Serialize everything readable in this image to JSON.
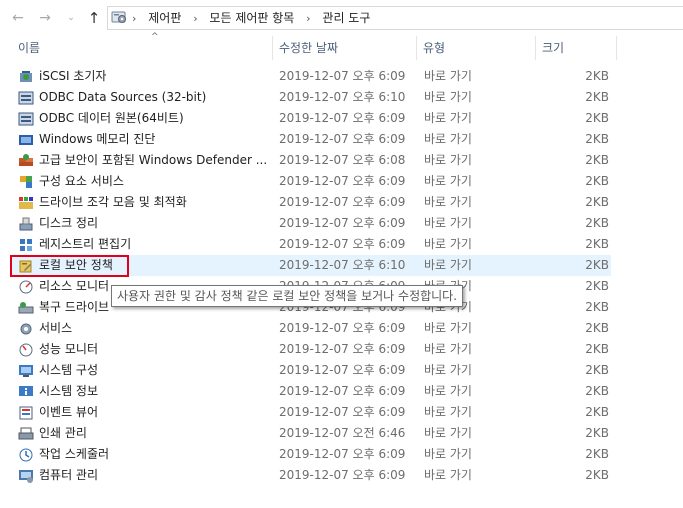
{
  "address": {
    "back_glyph": "←",
    "forward_glyph": "→",
    "dropdown_glyph": "⌄",
    "up_glyph": "↑",
    "breadcrumbs": [
      {
        "label": "제어판"
      },
      {
        "label": "모든 제어판 항목"
      },
      {
        "label": "관리 도구"
      }
    ],
    "separator": "›"
  },
  "columns": {
    "name": "이름",
    "date": "수정한 날짜",
    "type": "유형",
    "size": "크기",
    "sort_glyph": "^"
  },
  "files": [
    {
      "name": "iSCSI 초기자",
      "date": "2019-12-07 오후 6:09",
      "type": "바로 가기",
      "size": "2KB",
      "icon": "iscsi-icon"
    },
    {
      "name": "ODBC Data Sources (32-bit)",
      "date": "2019-12-07 오후 6:10",
      "type": "바로 가기",
      "size": "2KB",
      "icon": "odbc-icon"
    },
    {
      "name": "ODBC 데이터 원본(64비트)",
      "date": "2019-12-07 오후 6:09",
      "type": "바로 가기",
      "size": "2KB",
      "icon": "odbc-icon"
    },
    {
      "name": "Windows 메모리 진단",
      "date": "2019-12-07 오후 6:09",
      "type": "바로 가기",
      "size": "2KB",
      "icon": "memory-diagnostic-icon"
    },
    {
      "name": "고급 보안이 포함된 Windows Defender ...",
      "date": "2019-12-07 오후 6:08",
      "type": "바로 가기",
      "size": "2KB",
      "icon": "firewall-icon"
    },
    {
      "name": "구성 요소 서비스",
      "date": "2019-12-07 오후 6:09",
      "type": "바로 가기",
      "size": "2KB",
      "icon": "component-services-icon"
    },
    {
      "name": "드라이브 조각 모음 및 최적화",
      "date": "2019-12-07 오후 6:09",
      "type": "바로 가기",
      "size": "2KB",
      "icon": "defrag-icon"
    },
    {
      "name": "디스크 정리",
      "date": "2019-12-07 오후 6:09",
      "type": "바로 가기",
      "size": "2KB",
      "icon": "disk-cleanup-icon"
    },
    {
      "name": "레지스트리 편집기",
      "date": "2019-12-07 오후 6:09",
      "type": "바로 가기",
      "size": "2KB",
      "icon": "registry-icon"
    },
    {
      "name": "로컬 보안 정책",
      "date": "2019-12-07 오후 6:10",
      "type": "바로 가기",
      "size": "2KB",
      "icon": "security-policy-icon"
    },
    {
      "name": "리소스 모니터",
      "date": "2019-12-07 오후 6:09",
      "type": "바로 가기",
      "size": "2KB",
      "icon": "resource-monitor-icon"
    },
    {
      "name": "복구 드라이브",
      "date": "2019-12-07 오후 6:09",
      "type": "바로 가기",
      "size": "2KB",
      "icon": "recovery-drive-icon"
    },
    {
      "name": "서비스",
      "date": "2019-12-07 오후 6:09",
      "type": "바로 가기",
      "size": "2KB",
      "icon": "services-icon"
    },
    {
      "name": "성능 모니터",
      "date": "2019-12-07 오후 6:09",
      "type": "바로 가기",
      "size": "2KB",
      "icon": "performance-monitor-icon"
    },
    {
      "name": "시스템 구성",
      "date": "2019-12-07 오후 6:09",
      "type": "바로 가기",
      "size": "2KB",
      "icon": "system-config-icon"
    },
    {
      "name": "시스템 정보",
      "date": "2019-12-07 오후 6:09",
      "type": "바로 가기",
      "size": "2KB",
      "icon": "system-info-icon"
    },
    {
      "name": "이벤트 뷰어",
      "date": "2019-12-07 오후 6:09",
      "type": "바로 가기",
      "size": "2KB",
      "icon": "event-viewer-icon"
    },
    {
      "name": "인쇄 관리",
      "date": "2019-12-07 오전 6:46",
      "type": "바로 가기",
      "size": "2KB",
      "icon": "print-management-icon"
    },
    {
      "name": "작업 스케줄러",
      "date": "2019-12-07 오후 6:09",
      "type": "바로 가기",
      "size": "2KB",
      "icon": "task-scheduler-icon"
    },
    {
      "name": "컴퓨터 관리",
      "date": "2019-12-07 오후 6:09",
      "type": "바로 가기",
      "size": "2KB",
      "icon": "computer-management-icon"
    }
  ],
  "tooltip": {
    "text": "사용자 권한 및 감사 정책 같은 로컬 보안 정책을 보거나 수정합니다."
  },
  "colors": {
    "selection": "#e5f3ff",
    "highlight_box": "#e0001b",
    "header_text": "#4c607a"
  }
}
